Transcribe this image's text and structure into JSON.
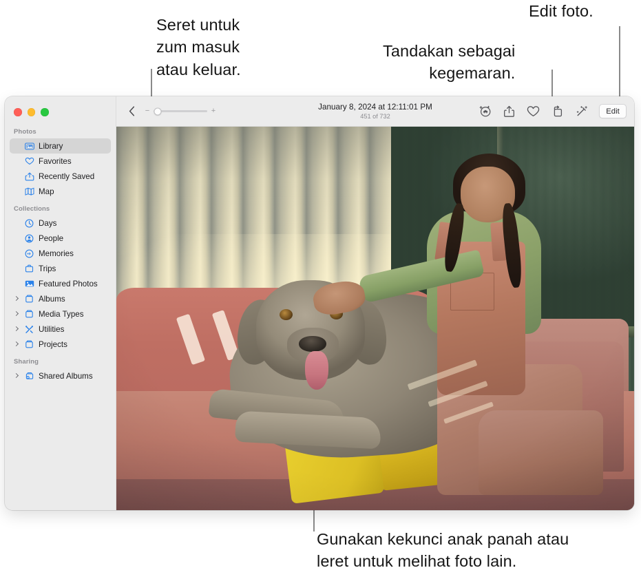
{
  "callouts": {
    "zoom": "Seret untuk\nzum masuk\natau keluar.",
    "favorite": "Tandakan sebagai\nkegemaran.",
    "edit": "Edit foto.",
    "navigate": "Gunakan kekunci anak panah atau\nleret untuk melihat foto lain."
  },
  "window": {
    "traffic_lights": [
      {
        "name": "close",
        "color": "#ff5f57"
      },
      {
        "name": "minimize",
        "color": "#febc2e"
      },
      {
        "name": "zoom",
        "color": "#28c840"
      }
    ]
  },
  "sidebar": {
    "sections": [
      {
        "title": "Photos",
        "items": [
          {
            "label": "Library",
            "icon": "library-icon",
            "selected": true,
            "disclosure": false
          },
          {
            "label": "Favorites",
            "icon": "heart-icon",
            "selected": false,
            "disclosure": false
          },
          {
            "label": "Recently Saved",
            "icon": "recently-saved-icon",
            "selected": false,
            "disclosure": false
          },
          {
            "label": "Map",
            "icon": "map-icon",
            "selected": false,
            "disclosure": false
          }
        ]
      },
      {
        "title": "Collections",
        "items": [
          {
            "label": "Days",
            "icon": "clock-icon",
            "selected": false,
            "disclosure": false
          },
          {
            "label": "People",
            "icon": "person-icon",
            "selected": false,
            "disclosure": false
          },
          {
            "label": "Memories",
            "icon": "memories-icon",
            "selected": false,
            "disclosure": false
          },
          {
            "label": "Trips",
            "icon": "trips-icon",
            "selected": false,
            "disclosure": false
          },
          {
            "label": "Featured Photos",
            "icon": "featured-photos-icon",
            "selected": false,
            "disclosure": false
          },
          {
            "label": "Albums",
            "icon": "album-icon",
            "selected": false,
            "disclosure": true
          },
          {
            "label": "Media Types",
            "icon": "album-icon",
            "selected": false,
            "disclosure": true
          },
          {
            "label": "Utilities",
            "icon": "utilities-icon",
            "selected": false,
            "disclosure": true
          },
          {
            "label": "Projects",
            "icon": "album-icon",
            "selected": false,
            "disclosure": true
          }
        ]
      },
      {
        "title": "Sharing",
        "items": [
          {
            "label": "Shared Albums",
            "icon": "shared-album-icon",
            "selected": false,
            "disclosure": true
          }
        ]
      }
    ],
    "accent_color": "#2b82ea"
  },
  "toolbar": {
    "back_label": "back-chevron",
    "zoom": {
      "minus": "−",
      "plus": "+",
      "value_percent": 8
    },
    "title": "January 8, 2024 at 12:11:01 PM",
    "subtitle": "451 of 732",
    "actions": [
      {
        "name": "visual-lookup-pet-icon",
        "label": "Look Up — Dog"
      },
      {
        "name": "share-icon",
        "label": "Share"
      },
      {
        "name": "heart-icon",
        "label": "Favorite"
      },
      {
        "name": "rotate-icon",
        "label": "Rotate"
      },
      {
        "name": "enhance-icon",
        "label": "Auto Enhance"
      }
    ],
    "edit_label": "Edit"
  },
  "photo": {
    "description": "Girl in rust corduroy overalls and green top sitting on a pink velvet couch petting a Weimaraner dog, yellow fringed blanket, vertical blinds and green damask wall behind."
  }
}
